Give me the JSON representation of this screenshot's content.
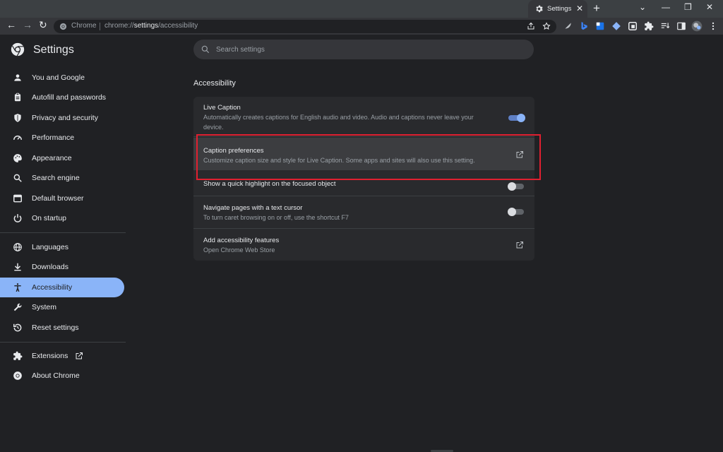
{
  "browser": {
    "tab_title": "Settings",
    "tab_close": "✕",
    "new_tab": "+",
    "window_controls": [
      "⌄",
      "—",
      "❐",
      "✕"
    ],
    "omnibox_site": "Chrome",
    "omnibox_url_prefix": "chrome://",
    "omnibox_url_path": "settings",
    "omnibox_url_suffix": "/accessibility",
    "toolbar_icons": [
      "share-icon",
      "bookmark-star-icon",
      "extension-feather-icon",
      "bing-icon",
      "blue-extension-icon",
      "diamond-extension-icon",
      "pdf-extension-icon",
      "puzzle-icon",
      "reading-list-icon",
      "side-panel-icon",
      "profile-avatar-icon",
      "menu-dots-icon"
    ],
    "nav": {
      "back": "←",
      "forward": "→",
      "reload": "↻"
    }
  },
  "settings": {
    "title": "Settings",
    "search_placeholder": "Search settings"
  },
  "sidebar": {
    "items": [
      {
        "label": "You and Google",
        "icon": "person-icon"
      },
      {
        "label": "Autofill and passwords",
        "icon": "clipboard-icon"
      },
      {
        "label": "Privacy and security",
        "icon": "shield-icon"
      },
      {
        "label": "Performance",
        "icon": "speedometer-icon"
      },
      {
        "label": "Appearance",
        "icon": "palette-icon"
      },
      {
        "label": "Search engine",
        "icon": "search-icon"
      },
      {
        "label": "Default browser",
        "icon": "browser-icon"
      },
      {
        "label": "On startup",
        "icon": "power-icon"
      },
      {
        "label": "Languages",
        "icon": "globe-icon"
      },
      {
        "label": "Downloads",
        "icon": "download-icon"
      },
      {
        "label": "Accessibility",
        "icon": "accessibility-icon",
        "active": true
      },
      {
        "label": "System",
        "icon": "wrench-icon"
      },
      {
        "label": "Reset settings",
        "icon": "reset-icon"
      },
      {
        "label": "Extensions",
        "icon": "puzzle-icon"
      },
      {
        "label": "About Chrome",
        "icon": "chrome-icon"
      }
    ]
  },
  "main": {
    "section_title": "Accessibility",
    "rows": [
      {
        "title": "Live Caption",
        "subtitle": "Automatically creates captions for English audio and video. Audio and captions never leave your device.",
        "control": "toggle",
        "on": true
      },
      {
        "title": "Caption preferences",
        "subtitle": "Customize caption size and style for Live Caption. Some apps and sites will also use this setting.",
        "control": "external-link"
      },
      {
        "title": "Show a quick highlight on the focused object",
        "subtitle": "",
        "control": "toggle",
        "on": false
      },
      {
        "title": "Navigate pages with a text cursor",
        "subtitle": "To turn caret browsing on or off, use the shortcut F7",
        "control": "toggle",
        "on": false
      },
      {
        "title": "Add accessibility features",
        "subtitle": "Open Chrome Web Store",
        "control": "external-link"
      }
    ]
  },
  "colors": {
    "accent": "#8ab4f8",
    "background": "#202124",
    "card": "#292a2d",
    "highlight_annotation": "#e02030"
  }
}
